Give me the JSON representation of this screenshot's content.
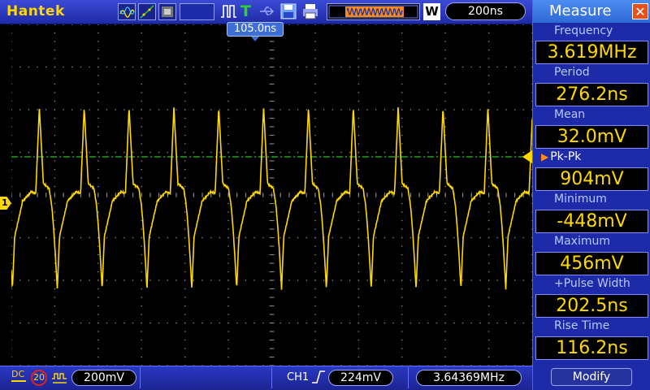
{
  "toolbar": {
    "brand": "Hantek",
    "trigger_indicator": "T",
    "waveform_indicator": "W",
    "timebase": "200ns"
  },
  "plot": {
    "trigger_position": "105.0ns",
    "channel_marker": "1",
    "colors": {
      "trace": "#ffd800",
      "grid": "#8a8a8a",
      "trigger_level": "#2fbf2f"
    }
  },
  "status": {
    "coupling": "DC",
    "bw_limit": "20",
    "ch_volts": "200mV",
    "trigger_source": "CH1",
    "trigger_level": "224mV",
    "counter_freq": "3.64369MHz"
  },
  "measure": {
    "title": "Measure",
    "close": "✕",
    "items": [
      {
        "label": "Frequency",
        "value": "3.619MHz"
      },
      {
        "label": "Period",
        "value": "276.2ns"
      },
      {
        "label": "Mean",
        "value": "32.0mV"
      },
      {
        "label": "Pk-Pk",
        "value": "904mV"
      },
      {
        "label": "Minimum",
        "value": "-448mV"
      },
      {
        "label": "Maximum",
        "value": "456mV"
      },
      {
        "label": "+Pulse Width",
        "value": "202.5ns"
      },
      {
        "label": "Rise Time",
        "value": "116.2ns"
      }
    ],
    "modify": "Modify"
  }
}
